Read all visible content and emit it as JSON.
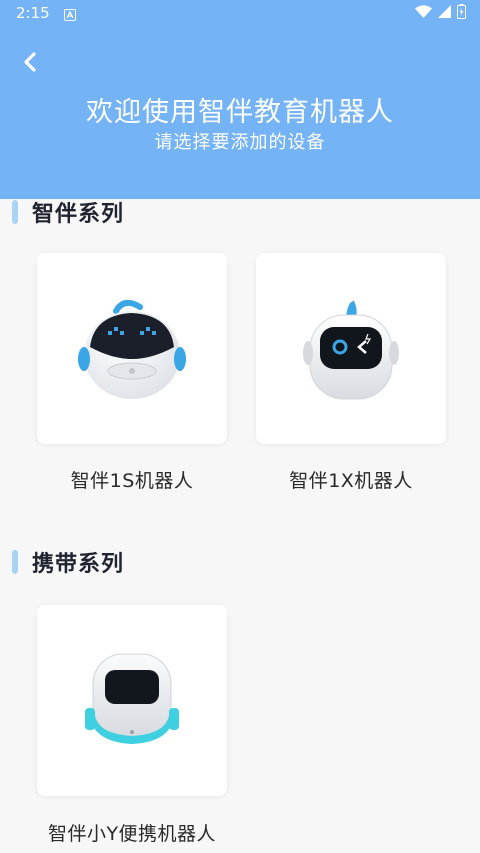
{
  "status_bar": {
    "time": "2:15"
  },
  "header": {
    "title": "欢迎使用智伴教育机器人",
    "subtitle": "请选择要添加的设备"
  },
  "sections": [
    {
      "title": "智伴系列",
      "devices": [
        {
          "name": "智伴1S机器人"
        },
        {
          "name": "智伴1X机器人"
        }
      ]
    },
    {
      "title": "携带系列",
      "devices": [
        {
          "name": "智伴小Y便携机器人"
        }
      ]
    }
  ],
  "colors": {
    "header": "#74b3f5",
    "accent_bar": "#a9d3f2",
    "robot_blue": "#3aa6e6"
  }
}
